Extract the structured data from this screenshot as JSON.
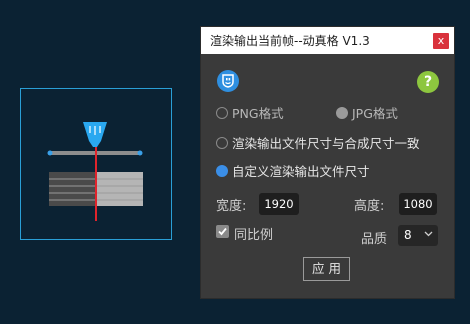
{
  "dialog": {
    "title": "渲染输出当前帧--动真格 V1.3",
    "close_label": "x",
    "help_label": "?"
  },
  "format": {
    "png_label": "PNG格式",
    "jpg_label": "JPG格式"
  },
  "size_mode": {
    "match_label": "渲染输出文件尺寸与合成尺寸一致",
    "custom_label": "自定义渲染输出文件尺寸"
  },
  "dimensions": {
    "width_label": "宽度:",
    "width_value": "1920",
    "height_label": "高度:",
    "height_value": "1080"
  },
  "options": {
    "keep_ratio_label": "同比例",
    "keep_ratio_checked": true,
    "quality_label": "品质",
    "quality_value": "8"
  },
  "apply_label": "应 用",
  "colors": {
    "background": "#0b2233",
    "dialog": "#3a3a3a",
    "accent": "#3b8fe8",
    "close": "#d9323c",
    "help": "#8dc63f",
    "preview_border": "#2a9fd6"
  }
}
